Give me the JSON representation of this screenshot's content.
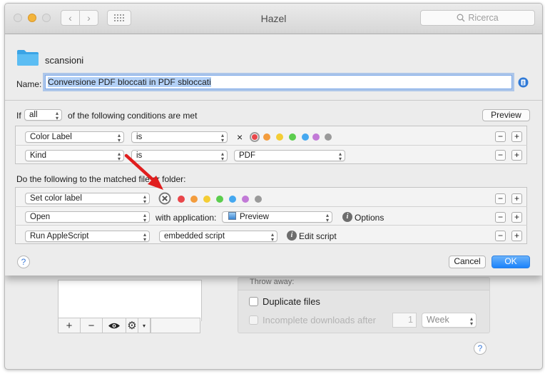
{
  "window": {
    "title": "Hazel",
    "search_placeholder": "Ricerca"
  },
  "rule": {
    "folder_name": "scansioni",
    "name_label": "Name:",
    "name_value": "Conversione PDF bloccati in PDF sbloccati"
  },
  "conditions": {
    "if_label": "If",
    "match_value": "all",
    "suffix": "of the following conditions are met",
    "preview_label": "Preview",
    "rows": [
      {
        "attribute": "Color Label",
        "operator": "is",
        "value_clear": "×"
      },
      {
        "attribute": "Kind",
        "operator": "is",
        "value": "PDF"
      }
    ]
  },
  "actions": {
    "heading": "Do the following to the matched file or folder:",
    "rows": [
      {
        "action": "Set color label"
      },
      {
        "action": "Open",
        "with_label": "with application:",
        "app": "Preview",
        "options_label": "Options"
      },
      {
        "action": "Run AppleScript",
        "script": "embedded script",
        "edit_label": "Edit script"
      }
    ]
  },
  "buttons": {
    "cancel": "Cancel",
    "ok": "OK",
    "help": "?",
    "plus": "+",
    "minus": "−"
  },
  "label_colors": [
    "#e9464a",
    "#f39c3d",
    "#f4cd35",
    "#5ccd4e",
    "#45a8f0",
    "#c27ad7",
    "#9a9a9a"
  ],
  "background": {
    "list_tools": [
      "+",
      "−",
      "eye-icon",
      "gear-icon"
    ],
    "panel_header": "Throw away:",
    "duplicate_label": "Duplicate files",
    "incomplete_label": "Incomplete downloads after",
    "incomplete_value": "1",
    "incomplete_unit": "Week",
    "help": "?"
  }
}
